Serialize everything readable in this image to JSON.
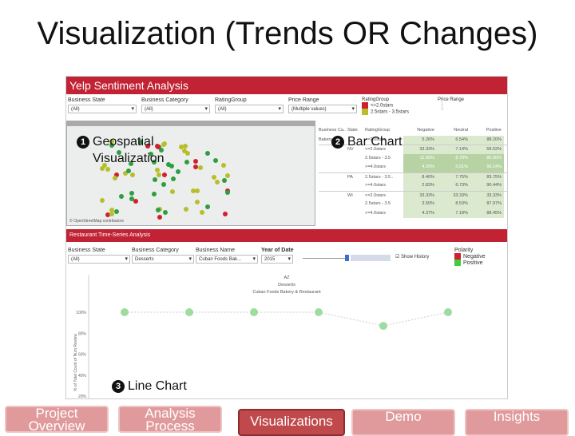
{
  "slide": {
    "title": "Visualization (Trends OR Changes)"
  },
  "dashboard": {
    "title": "Yelp Sentiment Analysis",
    "filters": [
      {
        "label": "Business State",
        "value": "(All)"
      },
      {
        "label": "Business Category",
        "value": "(All)"
      },
      {
        "label": "RatingGroup",
        "value": "(All)"
      },
      {
        "label": "Price Range",
        "value": "(Multiple values)"
      }
    ],
    "rating_legend": {
      "title": "RatingGroup",
      "items": [
        {
          "label": "<=2.0stars",
          "color": "#d0202e"
        },
        {
          "label": "2.5stars - 3.5stars",
          "color": "#b8be2a"
        }
      ]
    },
    "price_legend": {
      "title": "Price Range",
      "items": [
        "1",
        "2"
      ]
    },
    "map_attribution": "© OpenStreetMap contributors",
    "table": {
      "headers": [
        "Business Ca..",
        "State",
        "RatingGroup",
        "Negative",
        "Neutral",
        "Positive"
      ],
      "rows": [
        [
          "Bakery",
          "",
          "<=2.0stars",
          "5.26%",
          "6.54%",
          "88.20%"
        ],
        [
          "",
          "NV",
          "<=2.0stars",
          "33.33%",
          "7.14%",
          "59.52%"
        ],
        [
          "",
          "",
          "2.5stars - 3.5",
          "11.00%",
          "8.79%",
          "80.30%"
        ],
        [
          "",
          "",
          ">=4.0stars",
          "4.25%",
          "5.61%",
          "90.14%"
        ],
        [
          "",
          "PA",
          "2.5stars - 3.5..",
          "8.40%",
          "7.75%",
          "83.75%"
        ],
        [
          "",
          "",
          ">=4.0stars",
          "2.83%",
          "6.73%",
          "90.44%"
        ],
        [
          "",
          "WI",
          "<=2.0stars",
          "33.33%",
          "33.33%",
          "33.33%"
        ],
        [
          "",
          "",
          "2.5stars - 3.5",
          "3.50%",
          "8.53%",
          "87.97%"
        ],
        [
          "",
          "",
          ">=4.0stars",
          "4.37%",
          "7.18%",
          "88.45%"
        ]
      ]
    },
    "ts": {
      "title": "Restaurant Time-Series Analysis",
      "filters": [
        {
          "label": "Business State",
          "value": "(All)"
        },
        {
          "label": "Business Category",
          "value": "Desserts"
        },
        {
          "label": "Business Name",
          "value": "Cuban Foods Bak..."
        }
      ],
      "year": {
        "label": "Year of Date",
        "value": "2015"
      },
      "show_history": "Show History",
      "polarity": {
        "title": "Polarity",
        "items": [
          {
            "label": "Negative",
            "color": "#d0202e"
          },
          {
            "label": "Positive",
            "color": "#3ccf3c"
          }
        ]
      },
      "header_lines": [
        "AZ",
        "Desserts",
        "Cuban Foods Bakery & Restaurant"
      ]
    }
  },
  "annotations": {
    "a1_num": "1",
    "a1": "Geospatial Visualization",
    "a2_num": "2",
    "a2": "Bar Chart",
    "a3_num": "3",
    "a3": "Line Chart"
  },
  "chart_data": {
    "type": "line",
    "ylabel": "% of Total Count of Num Review",
    "yticks": [
      "100%",
      "80%",
      "60%",
      "40%",
      "20%"
    ],
    "ylim": [
      20,
      100
    ],
    "values": [
      100,
      100,
      100,
      100,
      87,
      100
    ],
    "color": "#9fdc9f"
  },
  "nav": [
    "Project Overview",
    "Analysis Process",
    "Visualizations",
    "Demo",
    "Insights"
  ],
  "nav_active": 2
}
